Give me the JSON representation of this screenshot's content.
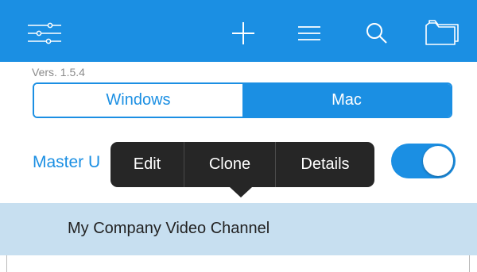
{
  "toolbar": {
    "background": "#1b8fe3",
    "icons": [
      "settings-sliders-icon",
      "add-icon",
      "list-icon",
      "search-icon",
      "folder-icon"
    ]
  },
  "version_label": "Vers. 1.5.4",
  "platform_selector": {
    "options": [
      "Windows",
      "Mac"
    ],
    "selected": "Mac"
  },
  "master_row": {
    "label": "Master U",
    "toggle_on": true
  },
  "context_menu": {
    "items": [
      "Edit",
      "Clone",
      "Details"
    ]
  },
  "list": {
    "items": [
      {
        "title": "My Company Video Channel",
        "selected": true
      }
    ]
  },
  "colors": {
    "accent": "#1b8fe3",
    "menu_background": "#262626",
    "selected_row": "#c7dff0"
  }
}
